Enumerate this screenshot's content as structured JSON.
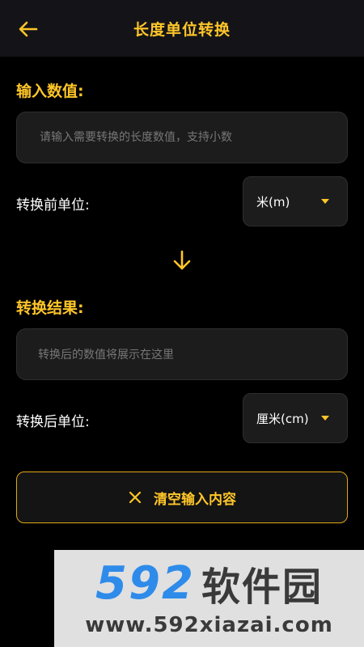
{
  "header": {
    "title": "长度单位转换",
    "back_icon": "arrow-left-icon"
  },
  "input_section": {
    "title": "输入数值:",
    "placeholder": "请输入需要转换的长度数值，支持小数",
    "value": ""
  },
  "from_unit": {
    "label": "转换前单位:",
    "selected": "米(m)"
  },
  "swap_icon": "arrow-down-icon",
  "result_section": {
    "title": "转换结果:",
    "placeholder": "转换后的数值将展示在这里"
  },
  "to_unit": {
    "label": "转换后单位:",
    "selected": "厘米(cm)"
  },
  "clear_button": {
    "label": "清空输入内容",
    "icon": "close-icon"
  },
  "watermark": {
    "digits": "592",
    "brand": "软件园",
    "url": "www.592xiazai.com"
  },
  "colors": {
    "accent": "#FFC629",
    "background": "#000000",
    "field": "#1c1c1c",
    "watermark_blue": "#2E8BEA"
  }
}
